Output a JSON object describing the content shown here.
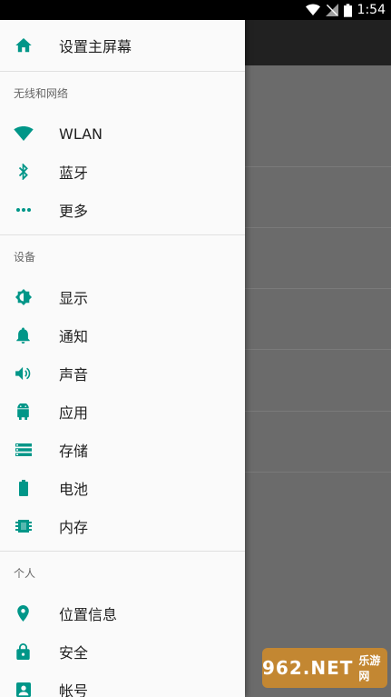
{
  "status_bar": {
    "time": "1:54",
    "icons": [
      "wifi-icon",
      "no-signal-icon",
      "battery-icon"
    ]
  },
  "drawer": {
    "home": {
      "label": "设置主屏幕",
      "icon": "home-icon"
    },
    "sections": [
      {
        "header": "无线和网络",
        "items": [
          {
            "label": "WLAN",
            "icon": "wifi-icon"
          },
          {
            "label": "蓝牙",
            "icon": "bluetooth-icon"
          },
          {
            "label": "更多",
            "icon": "more-dots-icon"
          }
        ]
      },
      {
        "header": "设备",
        "items": [
          {
            "label": "显示",
            "icon": "brightness-icon"
          },
          {
            "label": "通知",
            "icon": "bell-icon"
          },
          {
            "label": "声音",
            "icon": "volume-icon"
          },
          {
            "label": "应用",
            "icon": "android-icon"
          },
          {
            "label": "存储",
            "icon": "storage-icon"
          },
          {
            "label": "电池",
            "icon": "battery-icon"
          },
          {
            "label": "内存",
            "icon": "memory-chip-icon"
          }
        ]
      },
      {
        "header": "个人",
        "items": [
          {
            "label": "位置信息",
            "icon": "location-pin-icon"
          },
          {
            "label": "安全",
            "icon": "lock-icon"
          },
          {
            "label": "帐号",
            "icon": "account-box-icon"
          }
        ]
      }
    ]
  },
  "colors": {
    "accent": "#009688",
    "drawer_bg": "#fafafa",
    "scrim": "#6b6b6b",
    "toolbar": "#212121"
  },
  "watermark": {
    "main": "962.NET",
    "sub": "乐游网"
  }
}
